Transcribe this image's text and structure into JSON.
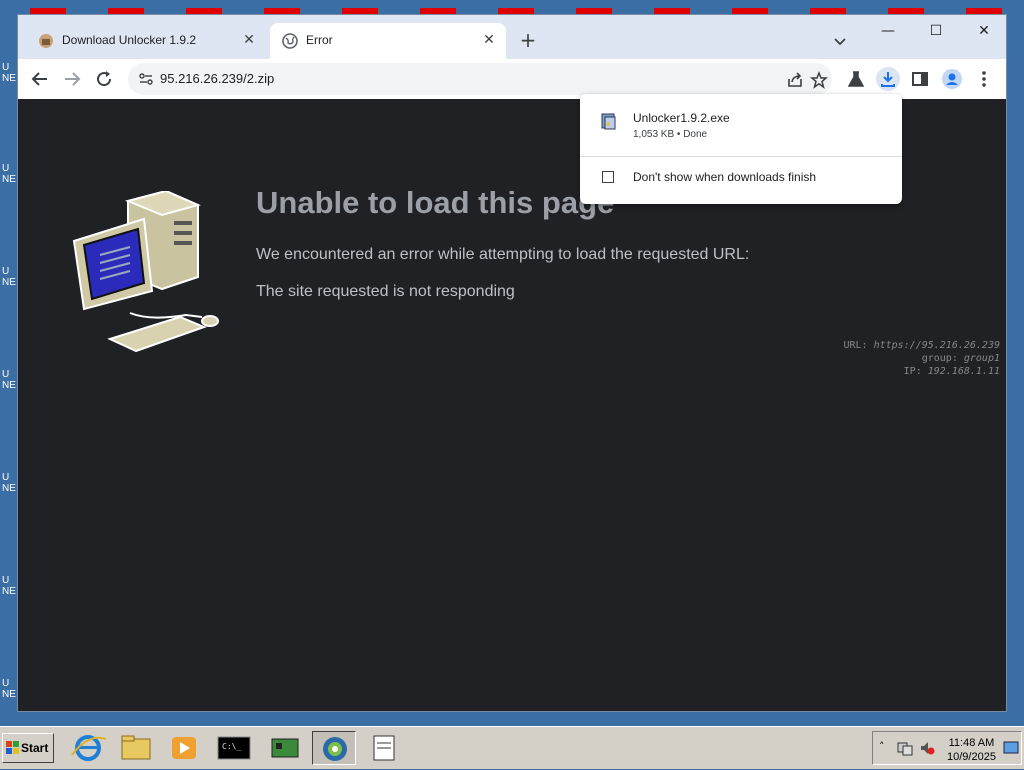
{
  "desktop": {
    "icon_labels": [
      "U",
      "NE",
      "U",
      "NE",
      "U",
      "NE",
      "U",
      "NE",
      "U",
      "NE",
      "U",
      "NE",
      "U",
      "NE"
    ]
  },
  "browser": {
    "tabs": [
      {
        "title": "Download Unlocker 1.9.2",
        "active": false
      },
      {
        "title": "Error",
        "active": true
      }
    ],
    "address": {
      "url": "95.216.26.239/2.zip"
    }
  },
  "error_page": {
    "title": "Unable to load this page",
    "line1": "We encountered an error while attempting to load the requested URL:",
    "line2": "The site requested is not responding",
    "meta": {
      "url_label": "URL:",
      "url_value": "https://95.216.26.239",
      "group_label": "group:",
      "group_value": "group1",
      "ip_label": "IP:",
      "ip_value": "192.168.1.11"
    }
  },
  "download_popup": {
    "file_name": "Unlocker1.9.2.exe",
    "file_status": "1,053 KB • Done",
    "checkbox_label": "Don't show when downloads finish"
  },
  "taskbar": {
    "start_label": "Start",
    "clock_time": "11:48 AM",
    "clock_date": "10/9/2025"
  },
  "colors": {
    "page_bg": "#202124",
    "tab_strip": "#dfe6f3",
    "desktop": "#3a6ea5",
    "taskbar": "#d4d0c8"
  }
}
